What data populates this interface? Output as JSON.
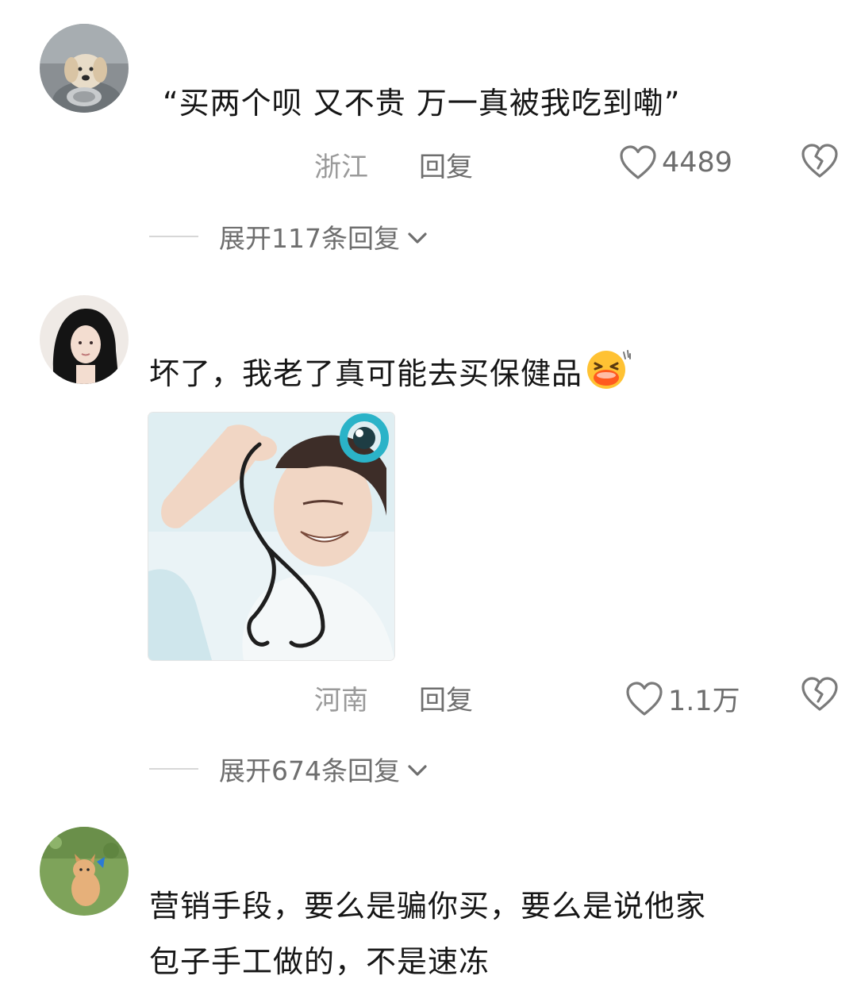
{
  "comments": [
    {
      "text": "“买两个呗 又不贵 万一真被我吃到嘞”",
      "location": "浙江",
      "reply_label": "回复",
      "likes": "4489",
      "expand_label": "展开117条回复"
    },
    {
      "text": "坏了，我老了真可能去买保健品",
      "location": "河南",
      "reply_label": "回复",
      "likes": "1.1万",
      "expand_label": "展开674条回复"
    },
    {
      "text_line1": "营销手段，要么是骗你买，要么是说他家",
      "text_line2": "包子手工做的，不是速冻"
    }
  ],
  "icons": {
    "like": "heart-outline-icon",
    "dislike": "broken-heart-icon",
    "expand": "chevron-down-icon",
    "emoji": "laughing-cry-emoji"
  },
  "colors": {
    "text": "#161616",
    "meta": "#9a9a9a",
    "secondary": "#6e6e6e",
    "divider": "#d7d7d7"
  }
}
